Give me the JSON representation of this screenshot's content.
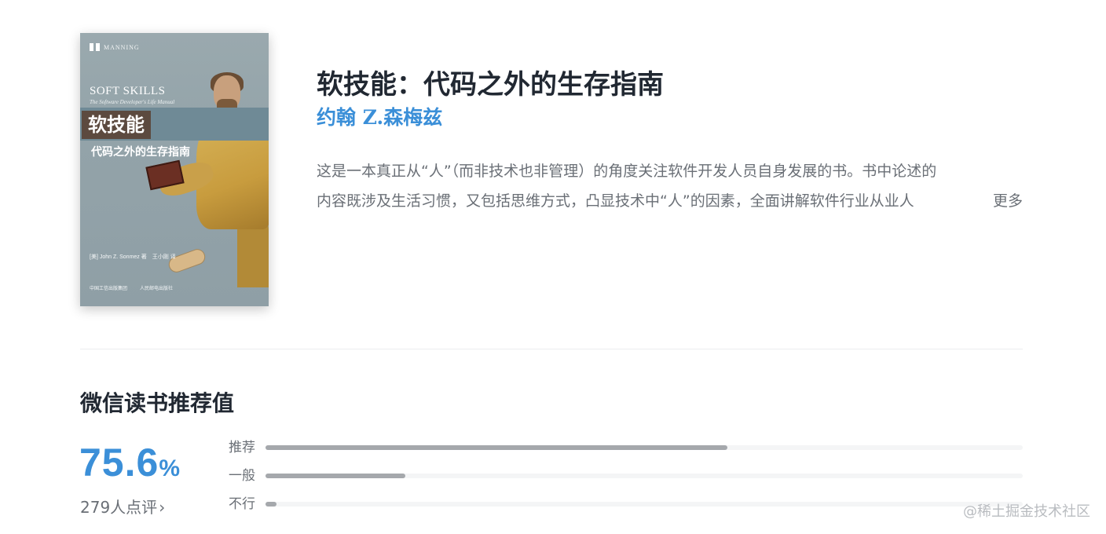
{
  "book": {
    "title": "软技能：代码之外的生存指南",
    "author": "约翰 Z.森梅兹",
    "intro_line1": "这是一本真正从“人”（而非技术也非管理）的角度关注软件开发人员自身发展的书。书中论述的",
    "intro_line2": "内容既涉及生活习惯，又包括思维方式，凸显技术中“人”的因素，全面讲解软件行业从业人",
    "more_label": "更多"
  },
  "cover": {
    "publisher": "MANNING",
    "en_title": "SOFT SKILLS",
    "en_subtitle": "The Software Developer's Life Manual",
    "cn_title": "软技能",
    "cn_subtitle": "代码之外的生存指南",
    "author_line": "[美] John Z. Sonmez 著　王小刚 译",
    "imprint_left": "中国工信出版集团",
    "imprint_right": "人民邮电出版社"
  },
  "recommendation": {
    "section_title": "微信读书推荐值",
    "score": "75.6",
    "score_unit": "%",
    "review_count_label": "279人点评",
    "review_chevron": "›",
    "accent_color": "#3b8fd8",
    "ratings": [
      {
        "label": "推荐",
        "fill_percent": 61
      },
      {
        "label": "一般",
        "fill_percent": 18.5
      },
      {
        "label": "不行",
        "fill_percent": 1.5
      }
    ]
  },
  "watermark": "@稀土掘金技术社区"
}
